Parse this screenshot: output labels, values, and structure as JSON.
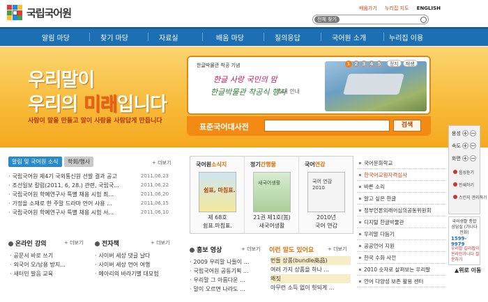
{
  "header": {
    "logo_text": "국립국어원",
    "top_links": [
      "배움가기",
      "누리집 지도",
      "ENGLISH"
    ],
    "search_label": "전체 찾기"
  },
  "nav": [
    "알림 마당",
    "찾기 마당",
    "자료실",
    "배움 마당",
    "질의응답",
    "국어원 소개",
    "누리집 이용"
  ],
  "hero": {
    "line1": "우리말이",
    "line2_pre": "우리의 ",
    "line2_em": "미래",
    "line2_post": "입니다",
    "sub": "사람이 말을 만들고 말이 사람을 사람답게 만듭니다"
  },
  "banner": {
    "title": "한글박물관 착공 기념",
    "line1": "한글 사랑 국민의 맘",
    "line2": "한글박물관 착공식 행사",
    "line3": "초대 안내",
    "pager": [
      "1",
      "2",
      "3",
      "4",
      "5"
    ],
    "stop": "정지",
    "play": "재생"
  },
  "dict": {
    "label": "표준국어대사전",
    "button": "검색"
  },
  "tools": {
    "size_label": "용성",
    "speed_label": "속도",
    "font_label": "화면",
    "links": [
      "음성듣기",
      "인쇄하기",
      "스킨지 관리하기"
    ]
  },
  "callbox": {
    "title": "국어생활 종합상담실 (가나다전화)",
    "number": "1599-9979",
    "link": "우리말 길라잡이 온라인가나다 질문하기"
  },
  "gotop": "▲위로 이동",
  "news": {
    "tab1": "알림 및 국어원 소식",
    "tab2": "학회/행사",
    "more": "+ 더보기",
    "items": [
      {
        "title": "국립국어원 제4기 국외통신원 선발 결과 공고",
        "date": "2011,06,23"
      },
      {
        "title": "조선일보 칼럼(2011, 6, 28.) 관련, 국립국...",
        "date": "2011,06,22"
      },
      {
        "title": "국립국어원 학예연구사 특별 채용 시험 최...",
        "date": "2011,06,20"
      },
      {
        "title": "가정을 소재로 한 주말 드라마 언어 사용 ...",
        "date": "2011,06,15"
      },
      {
        "title": "국립국어원 학예연구사 특별 채용 시험 서...",
        "date": "2011,06,10"
      }
    ]
  },
  "online": {
    "title": "온라인 강의",
    "more": "+ 더보기",
    "items": [
      "공문서 바로 쓰기",
      "외국어 오/남용 방지...",
      "새터민 발음 교육"
    ]
  },
  "exhibit": {
    "title": "전자책",
    "more": "+ 더보기",
    "items": [
      "사이버 세상 댓글 날다",
      "사이버 세상 언어 여행",
      "메아리의 바라기별 대모험"
    ]
  },
  "magazine": {
    "cols": [
      {
        "head": "국어원",
        "head_em": "소식지",
        "cover": "쉼표, 마침표.",
        "c1": "제 68호",
        "c2": "쉼표.마침표."
      },
      {
        "head": "정기",
        "head_em": "간행물",
        "cover": "새국어생활",
        "c1": "21권 제1호(봄)",
        "c2": "새국어생활"
      },
      {
        "head": "국어",
        "head_em": "연감",
        "cover": "국어 연감 2010",
        "c1": "2010년",
        "c2": "국어 연감"
      }
    ]
  },
  "promo": {
    "title": "홍보 영상",
    "more": "+ 더보기",
    "items": [
      "2009 우리말 나들이 ...",
      "국립국어원 공동기획 ...",
      "우리말 그 아름다운 ...",
      "말이 오르면 나라도 ..."
    ]
  },
  "pick": {
    "title": "이런 말도 있어요",
    "more": "+ 더보기",
    "items": [
      "번들 상품(bundle商品)",
      "여러 가지 상품을 하나 ...",
      "왜짓",
      "아무런 소득 없이 헛되게 ..."
    ]
  },
  "right_links": [
    "국어문화학교",
    "한국어교원자격심사",
    "바른 소리",
    "알고 싶은 한글",
    "정부언론외래어심의공동위원회",
    "디지털 한글박물관",
    "우리말 다듬기",
    "공공언어 지원",
    "한국 수화 사전",
    "2010 숫자로 살펴보는 우리말",
    "언어 다양성 보존 활용 센터"
  ]
}
